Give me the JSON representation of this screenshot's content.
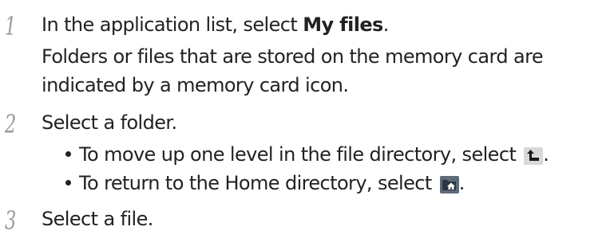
{
  "steps": [
    {
      "number": "1",
      "line1_pre": "In the application list, select ",
      "line1_bold": "My files",
      "line1_post": ".",
      "line2": "Folders or files that are stored on the memory card are",
      "line3": "indicated by a memory card icon."
    },
    {
      "number": "2",
      "text": "Select a folder.",
      "bullets": [
        {
          "text": "To move up one level in the file directory, select ",
          "icon": "up-level-icon",
          "suffix": "."
        },
        {
          "text": "To return to the Home directory, select ",
          "icon": "home-directory-icon",
          "suffix": "."
        }
      ]
    },
    {
      "number": "3",
      "text": "Select a file."
    }
  ]
}
